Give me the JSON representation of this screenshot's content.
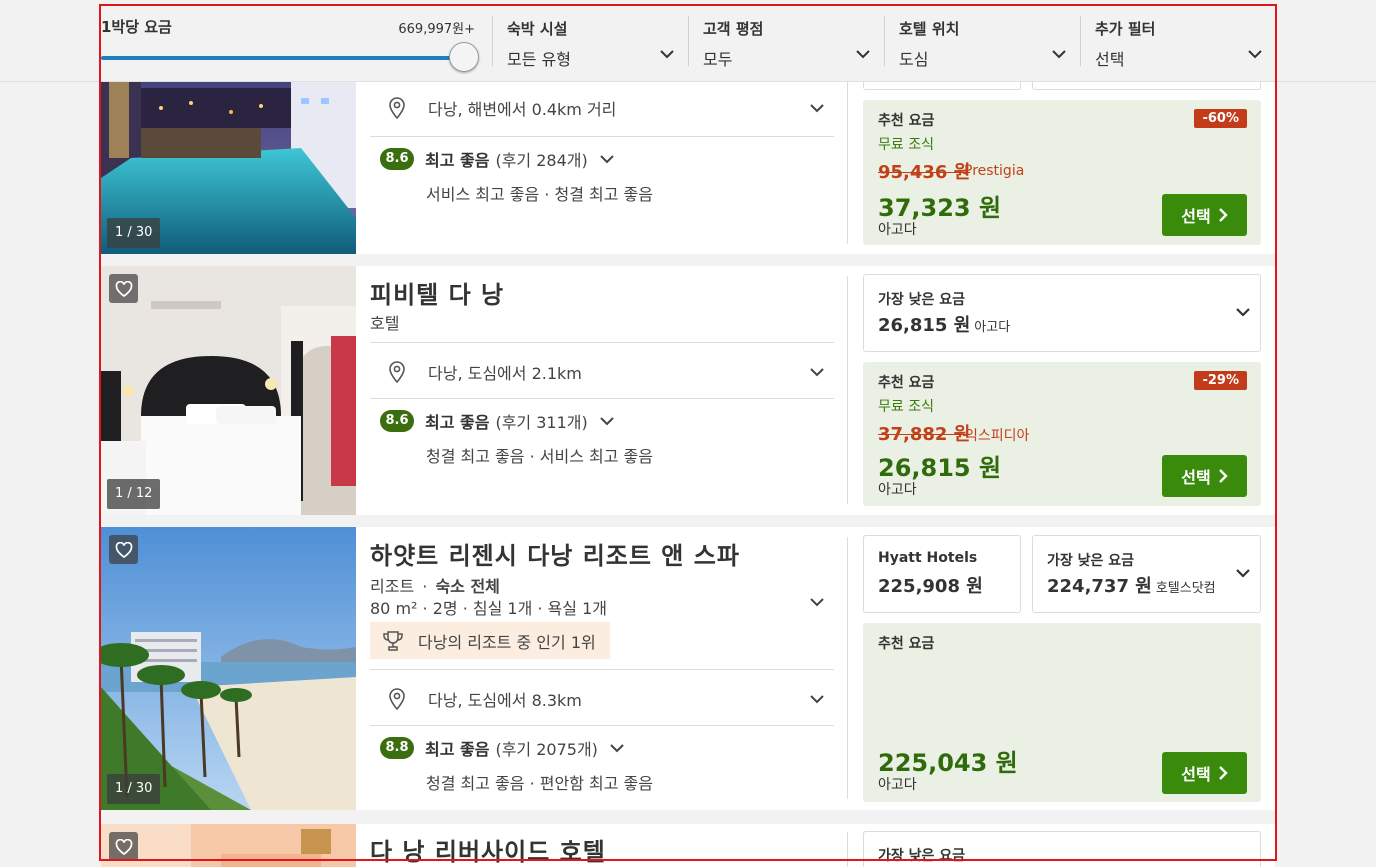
{
  "filters": {
    "price": {
      "title": "1박당 요금",
      "max": "669,997원+",
      "slider_level_pct": 100
    },
    "property_type": {
      "title": "숙박 시설",
      "value": "모든 유형"
    },
    "guest_rating": {
      "title": "고객 평점",
      "value": "모두"
    },
    "location": {
      "title": "호텔 위치",
      "value": "도심"
    },
    "more": {
      "title": "추가 필터",
      "value": "선택"
    }
  },
  "hotels": [
    {
      "photo_counter": "1 / 30",
      "location": "다낭, 해변에서 0.4km 거리",
      "score": "8.6",
      "rating_label": "최고 좋음",
      "review_count": "(후기 284개)",
      "rating_details": "서비스 최고 좋음 · 청결 최고 좋음",
      "deal": {
        "label": "추천 요금",
        "breakfast": "무료 조식",
        "old_price": "95,436 원",
        "old_source": "Prestigia",
        "price": "37,323 원",
        "vendor": "아고다",
        "discount": "-60%",
        "select": "선택"
      }
    },
    {
      "name": "피비텔 다 낭",
      "type": "호텔",
      "photo_counter": "1 / 12",
      "location": "다낭, 도심에서 2.1km",
      "score": "8.6",
      "rating_label": "최고 좋음",
      "review_count": "(후기 311개)",
      "rating_details": "청결 최고 좋음 · 서비스 최고 좋음",
      "lowest": {
        "label": "가장 낮은 요금",
        "price": "26,815 원",
        "vendor": "아고다"
      },
      "deal": {
        "label": "추천 요금",
        "breakfast": "무료 조식",
        "old_price": "37,882 원",
        "old_source": "익스피디아",
        "price": "26,815 원",
        "vendor": "아고다",
        "discount": "-29%",
        "select": "선택"
      }
    },
    {
      "name": "하얏트 리젠시 다낭 리조트 앤 스파",
      "type": "리조트",
      "type_extra": "숙소 전체",
      "specs": "80 m² · 2명 · 침실 1개 · 욕실 1개",
      "popular": "다낭의 리조트 중 인기 1위",
      "photo_counter": "1 / 30",
      "location": "다낭, 도심에서 8.3km",
      "score": "8.8",
      "rating_label": "최고 좋음",
      "review_count": "(후기 2075개)",
      "rating_details": "청결 최고 좋음 · 편안함 최고 좋음",
      "official": {
        "label": "Hyatt Hotels",
        "price": "225,908 원"
      },
      "lowest": {
        "label": "가장 낮은 요금",
        "price": "224,737 원",
        "vendor": "호텔스닷컴"
      },
      "deal": {
        "label": "추천 요금",
        "price": "225,043 원",
        "vendor": "아고다",
        "select": "선택"
      }
    },
    {
      "name": "다 낭 리버사이드 호텔",
      "lowest": {
        "label": "가장 낮은 요금"
      }
    }
  ]
}
